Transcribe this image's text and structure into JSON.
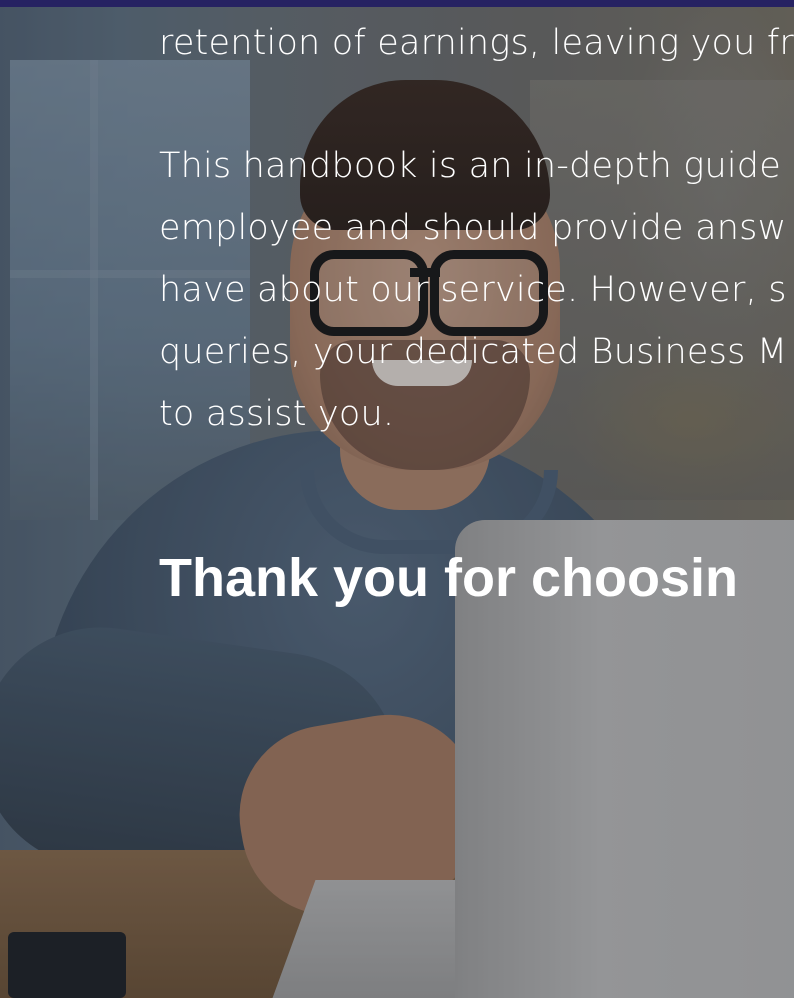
{
  "colors": {
    "top_bar": "#262262",
    "text": "#ffffff"
  },
  "background": {
    "image_description_icon": "person-at-laptop-photo"
  },
  "paragraph_1": {
    "lines": [
      "retention of earnings, leaving you fr"
    ]
  },
  "paragraph_2": {
    "lines": [
      "This handbook is an in-depth guide",
      "employee and should provide answ",
      "have about our service. However, s",
      "queries, your dedicated Business M",
      "to assist you."
    ]
  },
  "heading": {
    "text": "Thank you for choosin"
  }
}
